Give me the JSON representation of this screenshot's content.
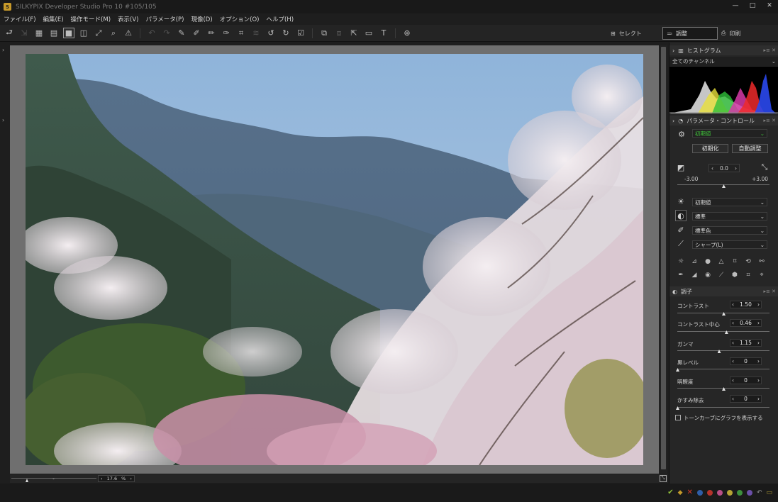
{
  "window": {
    "title": "SILKYPIX Developer Studio Pro 10  #105/105",
    "controls": {
      "minimize": "—",
      "maximize": "□",
      "close": "✕"
    }
  },
  "menu": [
    "ファイル(F)",
    "編集(E)",
    "操作モード(M)",
    "表示(V)",
    "パラメータ(P)",
    "現像(D)",
    "オプション(O)",
    "ヘルプ(H)"
  ],
  "modes": {
    "select": "セレクト",
    "adjust": "調整",
    "print": "印刷"
  },
  "viewer": {
    "zoom_value": "17.6",
    "zoom_unit": "%"
  },
  "histogram": {
    "title": "ヒストグラム",
    "channel": "全てのチャンネル"
  },
  "parameter_control": {
    "title": "パラメータ・コントロール",
    "taste": "初期値",
    "reset_button": "初期化",
    "auto_button": "自動調整",
    "exposure": {
      "value": "0.0",
      "min": "-3.00",
      "max": "+3.00",
      "level": 0.5
    },
    "white_balance": "初期値",
    "tone": "標準",
    "color": "標準色",
    "sharpness": "シャープ(L)"
  },
  "tone_section": {
    "title": "調子",
    "sliders": [
      {
        "label": "コントラスト",
        "value": "1.50",
        "level": 0.5
      },
      {
        "label": "コントラスト中心",
        "value": "0.46",
        "level": 0.53
      },
      {
        "label": "ガンマ",
        "value": "1.15",
        "level": 0.45
      },
      {
        "label": "黒レベル",
        "value": "0",
        "level": 0.0
      },
      {
        "label": "明瞭度",
        "value": "0",
        "level": 0.5
      },
      {
        "label": "かすみ除去",
        "value": "0",
        "level": 0.0
      }
    ],
    "tone_curve_checkbox": "トーンカーブにグラフを表示する"
  },
  "colors": {
    "label_dots": [
      "#b5a334",
      "#6a7a2a",
      "#b4332b",
      "#2f5ea8",
      "#3d8f3d",
      "#8f3d8f",
      "#6b4fa8",
      "#777777"
    ]
  }
}
